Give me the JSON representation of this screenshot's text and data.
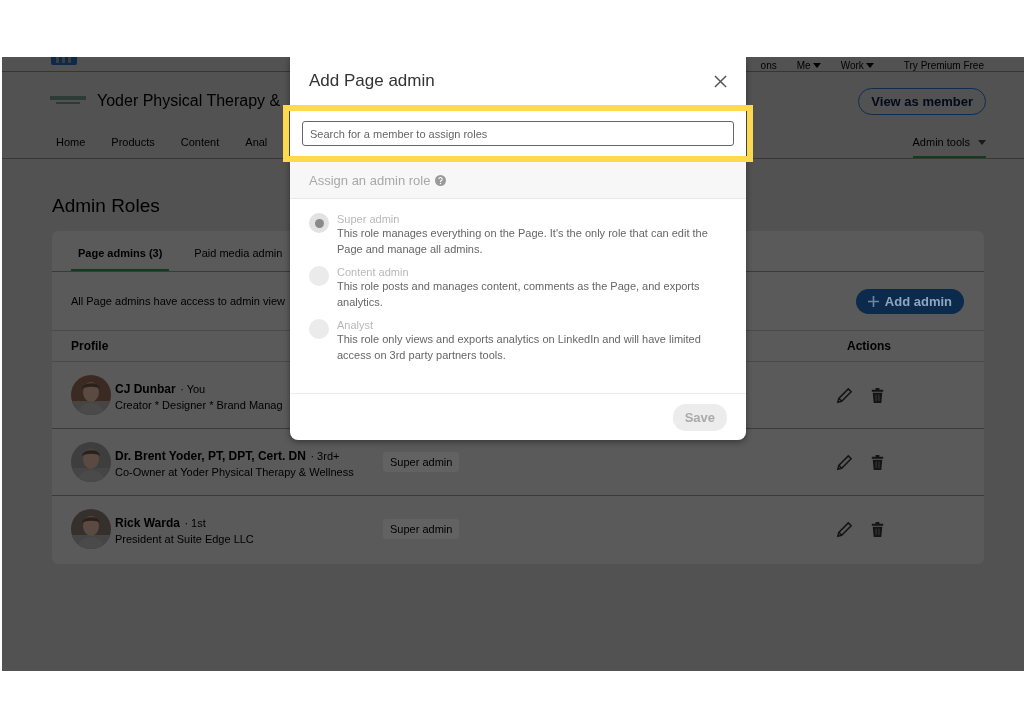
{
  "top_nav": {
    "items": [
      {
        "label": "ons",
        "caret": false
      },
      {
        "label": "Me",
        "caret": true
      },
      {
        "label": "Work",
        "caret": true
      }
    ],
    "premium": "Try Premium Free"
  },
  "page_header": {
    "name": "Yoder Physical Therapy &",
    "view_button": "View as member"
  },
  "page_nav": [
    {
      "label": "Home",
      "selected": false
    },
    {
      "label": "Products",
      "selected": false
    },
    {
      "label": "Content",
      "selected": false
    },
    {
      "label": "Anal",
      "selected": false
    }
  ],
  "admin_tools": {
    "label": "Admin tools",
    "selected": true
  },
  "heading": "Admin Roles",
  "tabs": [
    {
      "label": "Page admins (3)",
      "selected": true
    },
    {
      "label": "Paid media admin",
      "selected": false
    }
  ],
  "note": "All Page admins have access to admin view",
  "add_button": "Add admin",
  "table": {
    "columns": [
      "Profile",
      "Actions"
    ],
    "rows": [
      {
        "name": "CJ Dunbar",
        "relation": "· You",
        "headline": "Creator * Designer * Brand Manag"
      },
      {
        "name": "Dr. Brent Yoder, PT, DPT, Cert. DN",
        "relation": "· 3rd+",
        "headline": "Co-Owner at Yoder Physical Therapy & Wellness",
        "role": "Super admin"
      },
      {
        "name": "Rick Warda",
        "relation": "· 1st",
        "headline": "President at Suite Edge LLC",
        "role": "Super admin"
      }
    ]
  },
  "modal": {
    "title": "Add Page admin",
    "search": {
      "placeholder": "Search for a member to assign roles",
      "highlighted": true
    },
    "section_title": "Assign an admin role",
    "roles": [
      {
        "name": "Super admin",
        "description": "This role manages everything on the Page. It's the only role that can edit the Page and manage all admins.",
        "selected": true,
        "disabled": true
      },
      {
        "name": "Content admin",
        "description": "This role posts and manages content, comments as the Page, and exports analytics.",
        "selected": false,
        "disabled": true
      },
      {
        "name": "Analyst",
        "description": "This role only views and exports analytics on LinkedIn and will have limited access on 3rd party partners tools.",
        "selected": false,
        "disabled": true
      }
    ],
    "save": {
      "label": "Save",
      "disabled": true
    }
  }
}
